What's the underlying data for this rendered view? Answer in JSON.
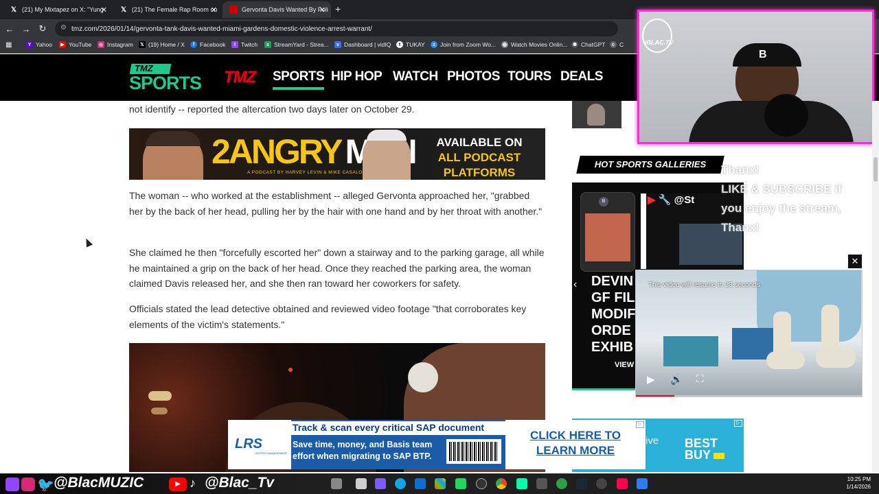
{
  "browser": {
    "tabs": [
      {
        "title": "(21) My Mixtapez on X: \"Yung",
        "icon": "x-logo-icon",
        "active": false
      },
      {
        "title": "(21) The Female Rap Room on",
        "icon": "x-logo-icon",
        "active": false
      },
      {
        "title": "Gervonta Davis Wanted By Poli",
        "icon": "tmz-favicon-icon",
        "active": true
      }
    ],
    "new_tab": "+",
    "url": "tmz.com/2026/01/14/gervonta-tank-davis-wanted-miami-gardens-domestic-violence-arrest-warrant/",
    "bookmarks": [
      "Yahoo",
      "YouTube",
      "Instagram",
      "(19) Home / X",
      "Facebook",
      "Twitch",
      "StreamYard - Strea...",
      "Dashboard | vidIQ",
      "TUKAY",
      "Join from Zoom Wo...",
      "Watch Movies Onlin...",
      "ChatGPT",
      "C"
    ]
  },
  "site": {
    "logo_tmz_sports": [
      "TMZ",
      "SPORTS"
    ],
    "logo_tmz": "TMZ",
    "nav": [
      "SPORTS",
      "HIP HOP",
      "WATCH",
      "PHOTOS",
      "TOURS",
      "DEALS"
    ],
    "nav_active": "SPORTS"
  },
  "article": {
    "p0": "not identify -- reported the altercation two days later on October 29.",
    "p1": "The woman -- who worked at the establishment -- alleged Gervonta approached her, \"grabbed her by the back of her head, pulling her by the hair with one hand and by her throat with another.\"",
    "p2": "She claimed he then \"forcefully escorted her\" down a stairway and to the parking garage, all while he maintained a grip on the back of her head. Once they reached the parking area, the woman claimed Davis released her, and she then ran toward her coworkers for safety.",
    "p3": "Officials stated the lead detective obtained and reviewed video footage \"that corroborates key elements of the victim's statements.\""
  },
  "ad_2angry": {
    "title_num": "2",
    "title_word1": "ANGRY",
    "title_word2": "MEN",
    "subtitle": "A PODCAST BY HARVEY LEVIN & MIKE CASALOS",
    "right_line1": "AVAILABLE ON",
    "right_line2": "ALL PODCAST PLATFORMS"
  },
  "sidebar": {
    "hot_galleries": "HOT SPORTS GALLERIES",
    "gallery_lines": [
      "DEVIN",
      "GF FIL",
      "MODIF",
      "ORDE",
      "EXHIB"
    ],
    "gallery_view": "VIEW G",
    "gallery_handle": "@St",
    "right_ad_text": "ssive",
    "right_ad_brand": [
      "BEST",
      "BUY"
    ]
  },
  "stream_overlay": {
    "webcam_label": "iBLAC.TV",
    "chat_lines": [
      "Thanx!",
      "LIKE & SUBSCRIBE if",
      "you enjoy the stream,",
      "Thanx!"
    ],
    "handle_1": "@BlacMUZIC",
    "handle_2": "@Blac_Tv"
  },
  "video": {
    "resume_text": "This video will resume in 23 seconds",
    "close": "✕",
    "progress": 0.17
  },
  "bottom_ad": {
    "logo": "LRS",
    "logo_sub": "OUTPUT MANAGEMENT",
    "headline": "Track & scan every critical SAP document",
    "body": "Save time, money, and Basis team effort when migrating to SAP BTP.",
    "cta": "CLICK HERE TO LEARN MORE"
  },
  "taskbar": {
    "time": "10:25 PM",
    "date": "1/14/2026"
  },
  "colors": {
    "tmz_green": "#1ec98f",
    "tmz_red": "#e2001a",
    "ad_gold": "#f5c518",
    "webcam_border": "#ff2bd6"
  }
}
